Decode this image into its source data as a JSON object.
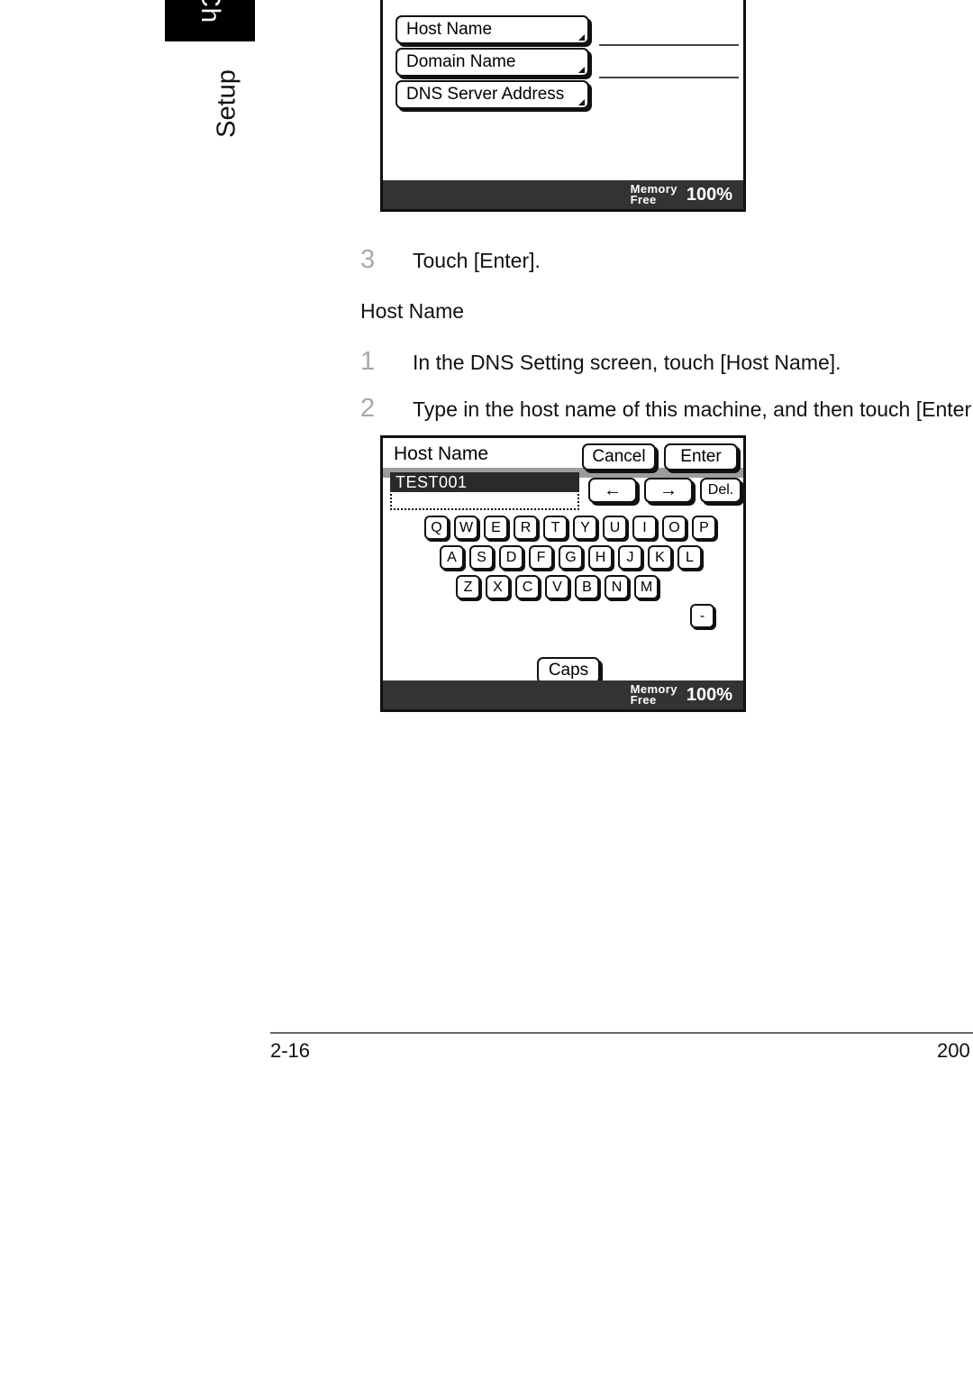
{
  "page": {
    "chapter_tab_label": "Ch",
    "side_label": "Setup",
    "footer_page_number": "2-16",
    "footer_right": "200"
  },
  "dns_screen": {
    "clipped_buttons": [
      "",
      ""
    ],
    "buttons": [
      {
        "label": "Host Name"
      },
      {
        "label": "Domain Name"
      },
      {
        "label": "DNS Server Address"
      }
    ],
    "status": {
      "memory_line1": "Memory",
      "memory_line2": "Free",
      "percent": "100%"
    }
  },
  "steps": [
    {
      "num": "3",
      "text": "Touch [Enter]."
    }
  ],
  "subhead": "Host Name",
  "host_steps": [
    {
      "num": "1",
      "text": "In the DNS Setting screen, touch [Host Name]."
    },
    {
      "num": "2",
      "text": "Type in the host name of this machine, and then touch [Enter"
    }
  ],
  "keyboard_screen": {
    "title": "Host Name",
    "cancel_label": "Cancel",
    "enter_label": "Enter",
    "input_value": "TEST001",
    "left_arrow": "←",
    "right_arrow": "→",
    "delete_label": "Del.",
    "row1": [
      "Q",
      "W",
      "E",
      "R",
      "T",
      "Y",
      "U",
      "I",
      "O",
      "P"
    ],
    "row2": [
      "A",
      "S",
      "D",
      "F",
      "G",
      "H",
      "J",
      "K",
      "L"
    ],
    "row3": [
      "Z",
      "X",
      "C",
      "V",
      "B",
      "N",
      "M"
    ],
    "hyphen_key": "-",
    "caps_label": "Caps",
    "status": {
      "memory_line1": "Memory",
      "memory_line2": "Free",
      "percent": "100%"
    }
  },
  "colors": {
    "status_bar": "#333333",
    "gray_band": "#9c9c9c",
    "input_highlight": "#2a2a2a",
    "step_number": "#a8a8a8"
  }
}
